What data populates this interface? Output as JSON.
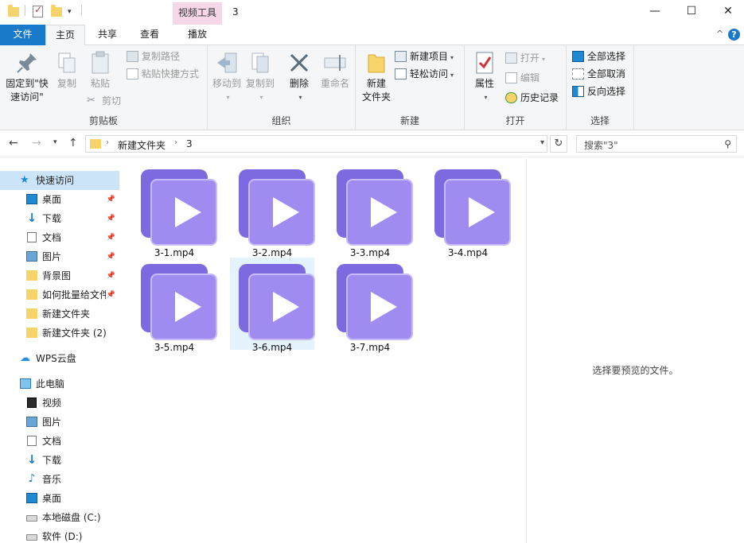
{
  "titlebar": {
    "context_tab": "视频工具",
    "title": "3",
    "minimize": "—",
    "maximize": "☐",
    "close": "✕"
  },
  "tabs": {
    "file": "文件",
    "home": "主页",
    "share": "共享",
    "view": "查看",
    "play": "播放",
    "collapse": "^",
    "help": "?"
  },
  "ribbon": {
    "clipboard": {
      "label": "剪贴板",
      "pin": "固定到\"快\n速访问\"",
      "pin_line1": "固定到\"快",
      "pin_line2": "速访问\"",
      "copy": "复制",
      "paste": "粘贴",
      "copy_path": "复制路径",
      "paste_shortcut": "粘贴快捷方式",
      "cut": "剪切"
    },
    "organize": {
      "label": "组织",
      "move_to": "移动到",
      "copy_to": "复制到",
      "delete": "删除",
      "rename": "重命名"
    },
    "new": {
      "label": "新建",
      "new_folder_line1": "新建",
      "new_folder_line2": "文件夹",
      "new_item": "新建项目",
      "easy_access": "轻松访问"
    },
    "open": {
      "label": "打开",
      "properties": "属性",
      "open": "打开",
      "edit": "编辑",
      "history": "历史记录"
    },
    "select": {
      "label": "选择",
      "select_all": "全部选择",
      "select_none": "全部取消",
      "invert": "反向选择"
    }
  },
  "address": {
    "crumbs": [
      "新建文件夹",
      "3"
    ],
    "search_placeholder": "搜索\"3\""
  },
  "nav": {
    "quick_access": "快速访问",
    "items": [
      {
        "label": "桌面",
        "icon": "desktop-icon",
        "pinned": true
      },
      {
        "label": "下载",
        "icon": "download-icon",
        "pinned": true
      },
      {
        "label": "文档",
        "icon": "document-icon",
        "pinned": true
      },
      {
        "label": "图片",
        "icon": "picture-icon",
        "pinned": true
      },
      {
        "label": "背景图",
        "icon": "folder-icon",
        "pinned": true
      },
      {
        "label": "如何批量给文件",
        "icon": "folder-icon",
        "pinned": true
      },
      {
        "label": "新建文件夹",
        "icon": "folder-icon",
        "pinned": false
      },
      {
        "label": "新建文件夹 (2)",
        "icon": "folder-icon",
        "pinned": false
      }
    ],
    "wps": "WPS云盘",
    "this_pc": "此电脑",
    "pc_items": [
      {
        "label": "视频",
        "icon": "video-icon"
      },
      {
        "label": "图片",
        "icon": "picture-icon"
      },
      {
        "label": "文档",
        "icon": "document-icon"
      },
      {
        "label": "下载",
        "icon": "download-icon"
      },
      {
        "label": "音乐",
        "icon": "music-icon"
      },
      {
        "label": "桌面",
        "icon": "desktop-icon"
      },
      {
        "label": "本地磁盘 (C:)",
        "icon": "drive-icon"
      },
      {
        "label": "软件 (D:)",
        "icon": "drive-icon"
      }
    ]
  },
  "files": [
    {
      "name": "3-1.mp4",
      "selected": false
    },
    {
      "name": "3-2.mp4",
      "selected": false
    },
    {
      "name": "3-3.mp4",
      "selected": false
    },
    {
      "name": "3-4.mp4",
      "selected": false
    },
    {
      "name": "3-5.mp4",
      "selected": false
    },
    {
      "name": "3-6.mp4",
      "selected": true
    },
    {
      "name": "3-7.mp4",
      "selected": false
    }
  ],
  "preview": {
    "message": "选择要预览的文件。"
  }
}
